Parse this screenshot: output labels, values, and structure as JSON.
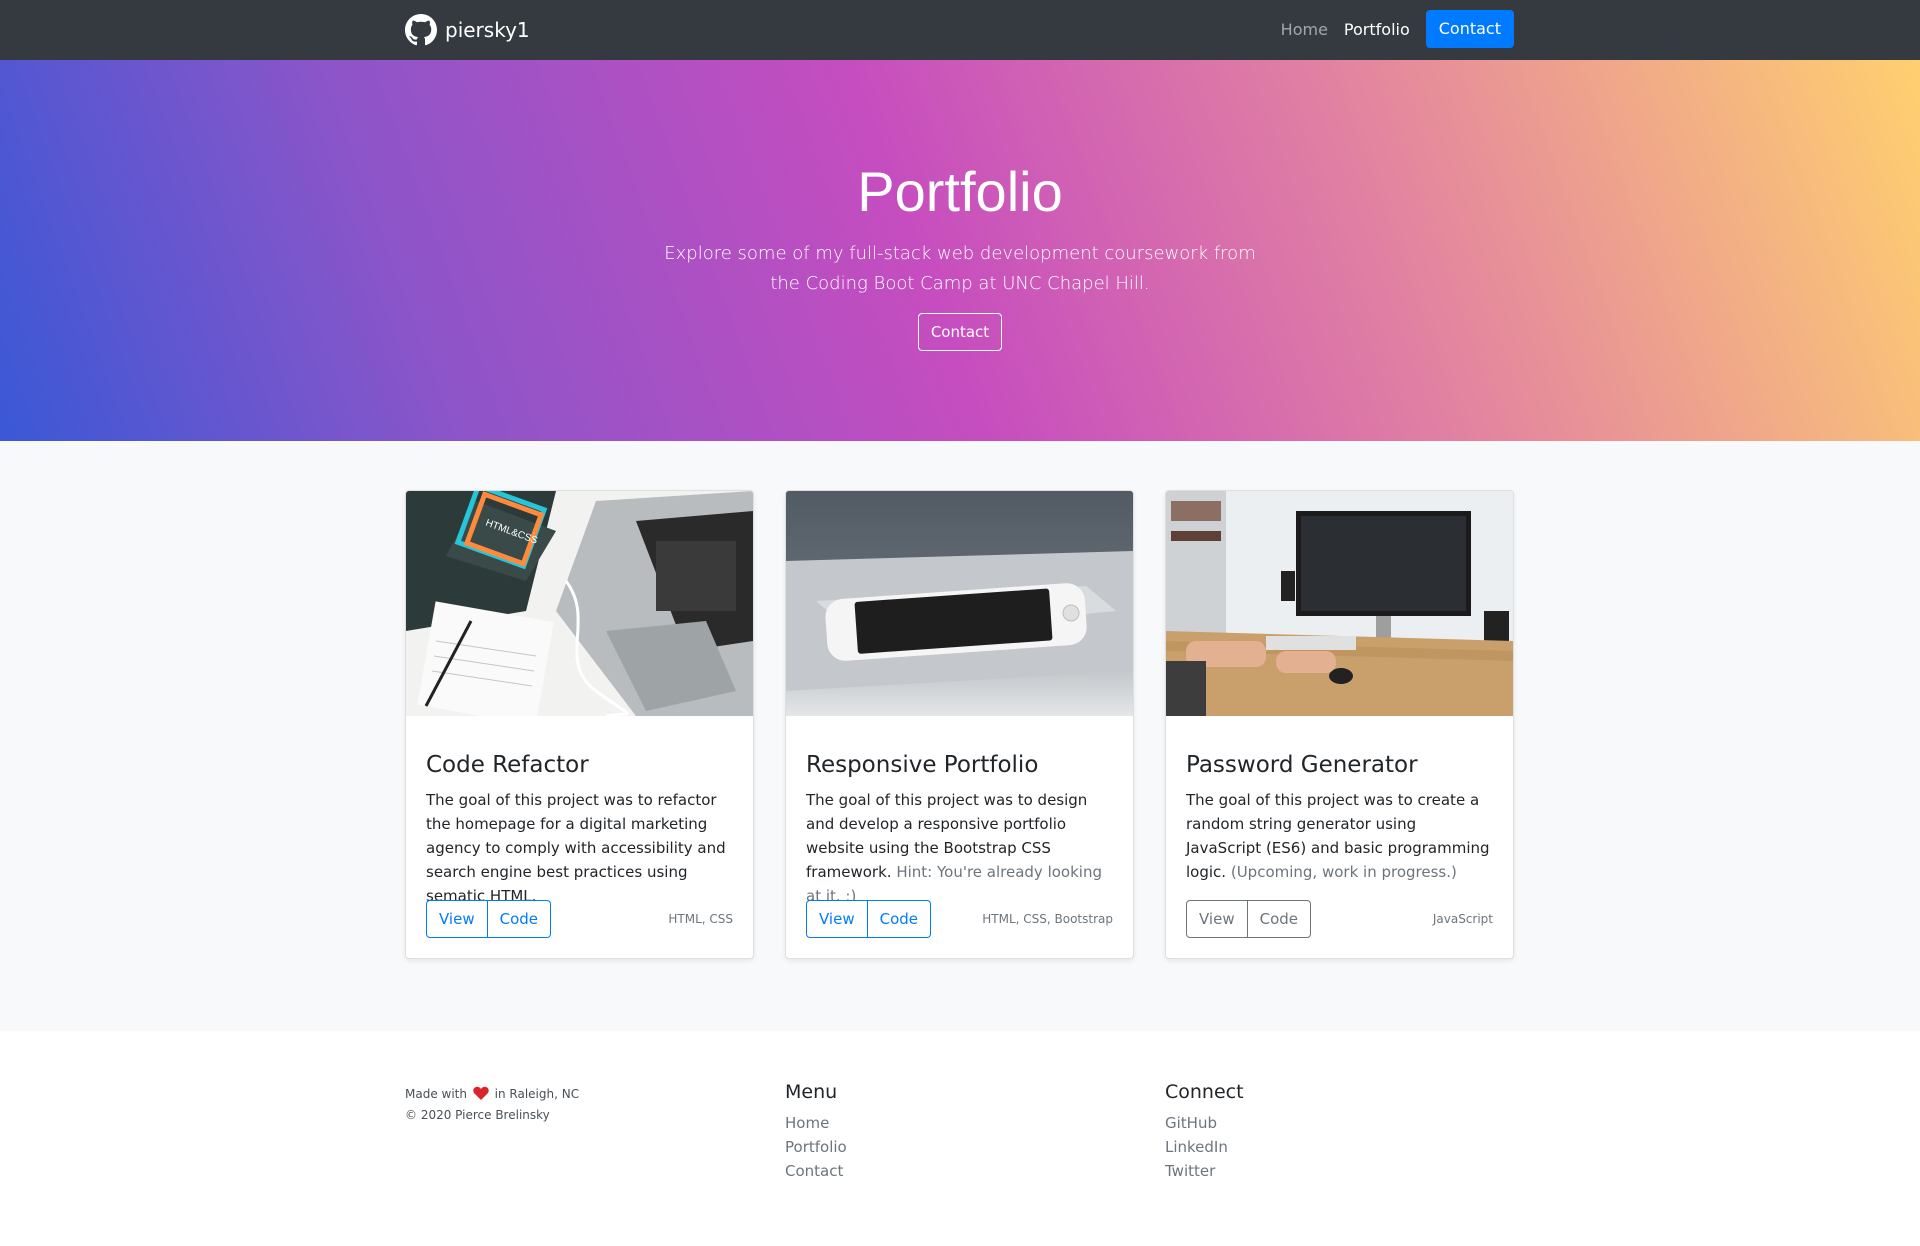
{
  "nav": {
    "brand": "piersky1",
    "links": [
      "Home",
      "Portfolio"
    ],
    "contact_button": "Contact"
  },
  "hero": {
    "title": "Portfolio",
    "subtitle": "Explore some of my full-stack web development coursework from the Coding Boot Camp at UNC Chapel Hill.",
    "button": "Contact"
  },
  "cards": [
    {
      "title": "Code Refactor",
      "text": "The goal of this project was to refactor the homepage for a digital marketing agency to comply with accessibility and search engine best practices using sematic HTML.",
      "muted": "",
      "view": "View",
      "code": "Code",
      "tags": "HTML, CSS",
      "image_label": "HTML&CSS"
    },
    {
      "title": "Responsive Portfolio",
      "text": "The goal of this project was to design and develop a responsive portfolio website using the Bootstrap CSS framework.",
      "muted": "Hint: You're already looking at it. ;)",
      "view": "View",
      "code": "Code",
      "tags": "HTML, CSS, Bootstrap"
    },
    {
      "title": "Password Generator",
      "text": "The goal of this project was to create a random string generator using JavaScript (ES6) and basic programming logic.",
      "muted": "(Upcoming, work in progress.)",
      "view": "View",
      "code": "Code",
      "tags": "JavaScript"
    }
  ],
  "footer": {
    "made_prefix": "Made with",
    "made_suffix": "in Raleigh, NC",
    "copyright": "© 2020 Pierce Brelinsky",
    "menu": {
      "title": "Menu",
      "items": [
        "Home",
        "Portfolio",
        "Contact"
      ]
    },
    "connect": {
      "title": "Connect",
      "items": [
        "GitHub",
        "LinkedIn",
        "Twitter"
      ]
    }
  },
  "colors": {
    "nav_bg": "#343a40",
    "primary": "#007bff",
    "section_bg": "#f8f9fa",
    "heart": "#d9242c"
  }
}
